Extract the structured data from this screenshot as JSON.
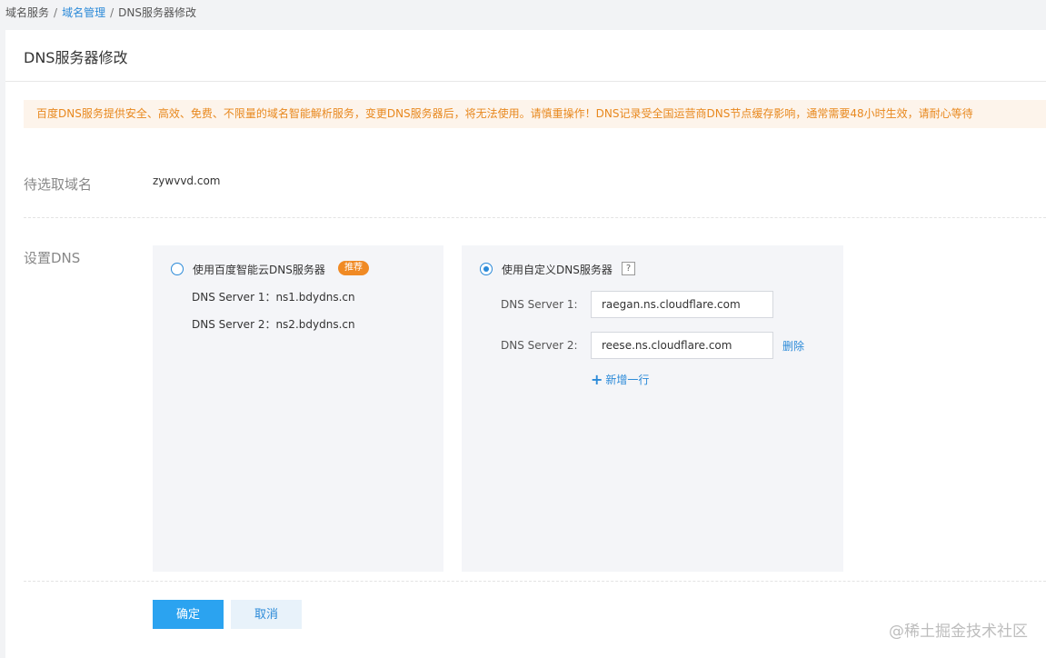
{
  "breadcrumb": {
    "items": [
      "域名服务",
      "域名管理",
      "DNS服务器修改"
    ],
    "separator": "/"
  },
  "page": {
    "title": "DNS服务器修改",
    "notice": "百度DNS服务提供安全、高效、免费、不限量的域名智能解析服务，变更DNS服务器后，将无法使用。请慎重操作！DNS记录受全国运营商DNS节点缓存影响，通常需要48小时生效，请耐心等待"
  },
  "domain": {
    "label": "待选取域名",
    "value": "zywvvd.com"
  },
  "dns": {
    "label": "设置DNS",
    "baidu_option": {
      "label": "使用百度智能云DNS服务器",
      "badge": "推荐",
      "selected": false,
      "servers": [
        "DNS Server 1：ns1.bdydns.cn",
        "DNS Server 2：ns2.bdydns.cn"
      ]
    },
    "custom_option": {
      "label": "使用自定义DNS服务器",
      "help": "?",
      "selected": true,
      "server1_label": "DNS Server 1:",
      "server1_value": "raegan.ns.cloudflare.com",
      "server2_label": "DNS Server 2:",
      "server2_value": "reese.ns.cloudflare.com",
      "delete_label": "删除",
      "add_row_label": "新增一行",
      "add_icon": "+"
    }
  },
  "actions": {
    "confirm": "确定",
    "cancel": "取消"
  },
  "watermark": "@稀土掘金技术社区",
  "colors": {
    "accent": "#2b8ad8",
    "primary_button": "#2ba3f0",
    "notice_text": "#e8881e",
    "notice_bg": "#fdf4eb",
    "badge": "#f08a24"
  }
}
